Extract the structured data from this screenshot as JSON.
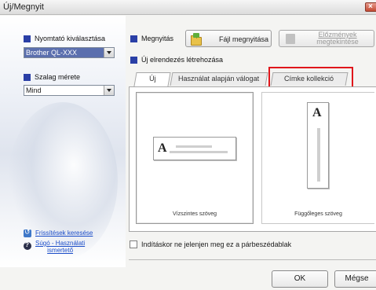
{
  "window": {
    "title": "Új/Megnyit",
    "close_glyph": "×"
  },
  "left": {
    "printer_label": "Nyomtató kiválasztása",
    "printer_value": "Brother QL-XXX",
    "tape_label": "Szalag mérete",
    "tape_value": "Mind",
    "links": {
      "updates": "Frissítések keresése",
      "help_line1": "Súgó - Használati",
      "help_line2": "ismertető"
    }
  },
  "top": {
    "open_label": "Megnyitás",
    "open_file_button": "Fájl megnyitása",
    "history_line1": "Előzmények",
    "history_line2": "megtekintése",
    "create_new_label": "Új elrendezés létrehozása"
  },
  "tabs": [
    {
      "label": "Új",
      "active": true
    },
    {
      "label": "Használat alapján válogat",
      "active": false
    },
    {
      "label": "Címke kollekció",
      "active": false
    }
  ],
  "cards": [
    {
      "caption": "Vízszintes szöveg",
      "glyph": "A"
    },
    {
      "caption": "Függőleges szöveg",
      "glyph": "A"
    }
  ],
  "startup_checkbox": {
    "label": "Indításkor ne jelenjen meg ez a párbeszédablak",
    "checked": false
  },
  "buttons": {
    "ok": "OK",
    "cancel": "Mégse"
  },
  "colors": {
    "section_marker": "#2a3fa6",
    "highlight": "#e0161b",
    "link": "#1a4cc8"
  },
  "icons": [
    "close-icon",
    "folder-open-icon",
    "document-preview-icon",
    "refresh-icon",
    "help-icon",
    "chevron-down-icon"
  ]
}
